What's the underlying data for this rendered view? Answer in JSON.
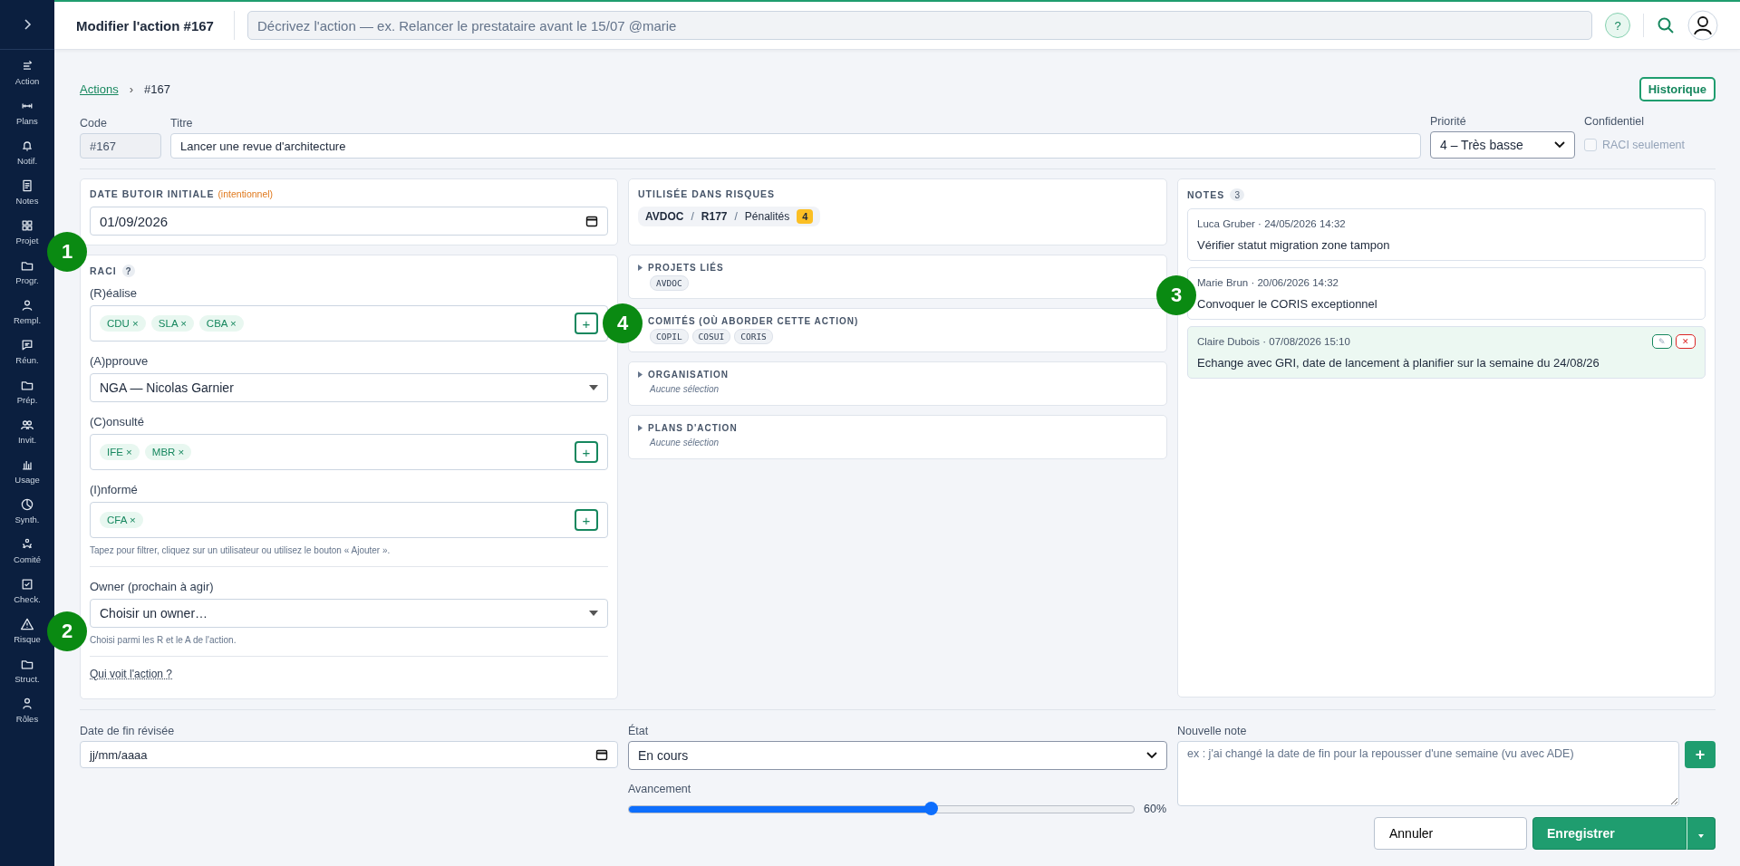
{
  "sidebar": {
    "items": [
      {
        "label": "Action"
      },
      {
        "label": "Plans"
      },
      {
        "label": "Notif."
      },
      {
        "label": "Notes"
      },
      {
        "label": "Projet"
      },
      {
        "label": "Progr."
      },
      {
        "label": "Rempl."
      },
      {
        "label": "Réun."
      },
      {
        "label": "Prép."
      },
      {
        "label": "Invit."
      },
      {
        "label": "Usage"
      },
      {
        "label": "Synth."
      },
      {
        "label": "Comité"
      },
      {
        "label": "Check."
      },
      {
        "label": "Risque"
      },
      {
        "label": "Struct."
      },
      {
        "label": "Rôles"
      }
    ]
  },
  "topbar": {
    "title": "Modifier l'action #167",
    "search": {
      "placeholder": "Décrivez l'action — ex. Relancer le prestataire avant le 15/07 @marie"
    },
    "help": "?"
  },
  "breadcrumb": {
    "link": "Actions",
    "separator": "›",
    "current": "#167"
  },
  "history_button": "Historique",
  "header_fields": {
    "code": {
      "label": "Code",
      "value": "#167"
    },
    "title": {
      "label": "Titre",
      "value": "Lancer une revue d'architecture"
    },
    "priority": {
      "label": "Priorité",
      "value": "4 – Très basse"
    },
    "confidential": {
      "label": "Confidentiel",
      "checkbox_label": "RACI seulement",
      "checked": false
    }
  },
  "initial_deadline": {
    "label": "DATE BUTOIR INITIALE",
    "note": "(intentionnel)",
    "value": "01/09/2026"
  },
  "raci": {
    "title": "RACI",
    "help": "?",
    "roles": [
      {
        "label": "(R)éalise",
        "kind": "tags",
        "tags": [
          "CDU",
          "SLA",
          "CBA"
        ],
        "add": "+"
      },
      {
        "label": "(A)pprouve",
        "kind": "select",
        "value": "NGA — Nicolas Garnier"
      },
      {
        "label": "(C)onsulté",
        "kind": "tags",
        "tags": [
          "IFE",
          "MBR"
        ],
        "add": "+"
      },
      {
        "label": "(I)nformé",
        "kind": "tags",
        "tags": [
          "CFA"
        ],
        "add": "+"
      }
    ],
    "remove": "×",
    "hint": "Tapez pour filtrer, cliquez sur un utilisateur ou utilisez le bouton « Ajouter ».",
    "owner": {
      "label": "Owner (prochain à agir)",
      "value": "Choisir un owner…",
      "hint": "Choisi parmi les R et le A de l'action."
    },
    "visibility_link": "Qui voit l'action ?"
  },
  "risks": {
    "title": "UTILISÉE DANS RISQUES",
    "path": [
      "AVDOC",
      "R177",
      "Pénalités"
    ],
    "separator": "/",
    "count": "4"
  },
  "sections": [
    {
      "title": "PROJETS LIÉS",
      "chips": [
        "AVDOC"
      ]
    },
    {
      "title": "COMITÉS (OÙ ABORDER CETTE ACTION)",
      "chips": [
        "COPIL",
        "COSUI",
        "CORIS"
      ]
    },
    {
      "title": "ORGANISATION",
      "empty": "Aucune sélection"
    },
    {
      "title": "PLANS D'ACTION",
      "empty": "Aucune sélection"
    }
  ],
  "notes": {
    "title": "NOTES",
    "count": "3",
    "items": [
      {
        "meta": "Luca Gruber · 24/05/2026 14:32",
        "text": "Vérifier statut migration zone tampon",
        "editable": false
      },
      {
        "meta": "Marie Brun · 20/06/2026 14:32",
        "text": "Convoquer le CORIS exceptionnel",
        "editable": false
      },
      {
        "meta": "Claire Dubois · 07/08/2026 15:10",
        "text": "Echange avec GRI, date de lancement à planifier sur la semaine du 24/08/26",
        "editable": true,
        "edit": "✎",
        "delete": "✕"
      }
    ]
  },
  "footer": {
    "revised_date": {
      "label": "Date de fin révisée",
      "placeholder": "jj/mm/aaaa"
    },
    "state": {
      "label": "État",
      "value": "En cours"
    },
    "progress": {
      "label": "Avancement",
      "level": 0.6,
      "reading": "60%"
    },
    "new_note": {
      "label": "Nouvelle note",
      "placeholder": "ex : j'ai changé la date de fin pour la repousser d'une semaine (vu avec ADE)",
      "add": "+"
    },
    "cancel": "Annuler",
    "save": "Enregistrer"
  },
  "markers": [
    "1",
    "2",
    "3",
    "4"
  ]
}
